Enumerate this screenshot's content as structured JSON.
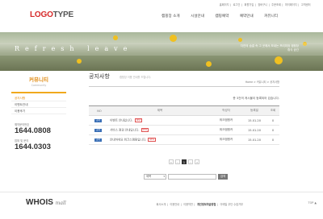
{
  "header": {
    "logo_red": "LOGO",
    "logo_grey": "TYPE",
    "util_links": [
      "홈페이지",
      "로그인",
      "회원가입",
      "장바구니",
      "주문조회",
      "마이페이지",
      "고객센터"
    ],
    "gnb": [
      "캠핑장 소개",
      "시설안내",
      "캠핑예약",
      "예약안내",
      "커뮤니티"
    ]
  },
  "banner": {
    "title": "Refresh leave",
    "caption_line1": "자연의 숨결 속 그 곳에서 보내는 프리미엄 캠핑장",
    "caption_line2": "휴식 공간"
  },
  "lnb": {
    "title": "커뮤니티",
    "subtitle": "Community",
    "menu": [
      "공지사항",
      "이벤트안내",
      "이용후기"
    ],
    "cs": [
      {
        "label": "예약문의번호",
        "number": "1644.0808"
      },
      {
        "label": "업체 및 문의",
        "number": "1644.0303"
      }
    ]
  },
  "content": {
    "title": "공지사항",
    "subtitle": "캠핑장 이용 안내를 드립니다.",
    "breadcrumb": "Home > 커뮤니티 > 공지사항",
    "total": "총 3건의 게시물이 등록되어 있습니다."
  },
  "table": {
    "headers": [
      "NO",
      "제목",
      "작성자",
      "등록일",
      "조회"
    ],
    "rows": [
      {
        "no": "공지",
        "subject": "이벤트 안내입니다.",
        "author": "워크캠핑카",
        "date": "15.01.20",
        "views": "0"
      },
      {
        "no": "공지",
        "subject": "서비스 점검 안내입니다.",
        "author": "워크캠핑카",
        "date": "15.01.20",
        "views": "0"
      },
      {
        "no": "공지",
        "subject": "안내하세요 워크스캠핑입니다.",
        "author": "워크캠핑카",
        "date": "15.01.20",
        "views": "0"
      }
    ],
    "new_label": "NEW"
  },
  "pager": {
    "first": "«",
    "prev": "‹",
    "current": "1",
    "next": "›",
    "last": "»"
  },
  "search": {
    "select_value": "제목",
    "button": "검색"
  },
  "footer": {
    "logo": "WHOIS",
    "logo_sub": "mall",
    "links": [
      "회사소개",
      "이용안내",
      "이용약관",
      "개인정보취급방침",
      "이메일 무단 수집거부"
    ],
    "top": "TOP"
  },
  "colors": {
    "accent": "#d62a2a",
    "orange": "#e08a10",
    "badge": "#3a6fb6"
  }
}
